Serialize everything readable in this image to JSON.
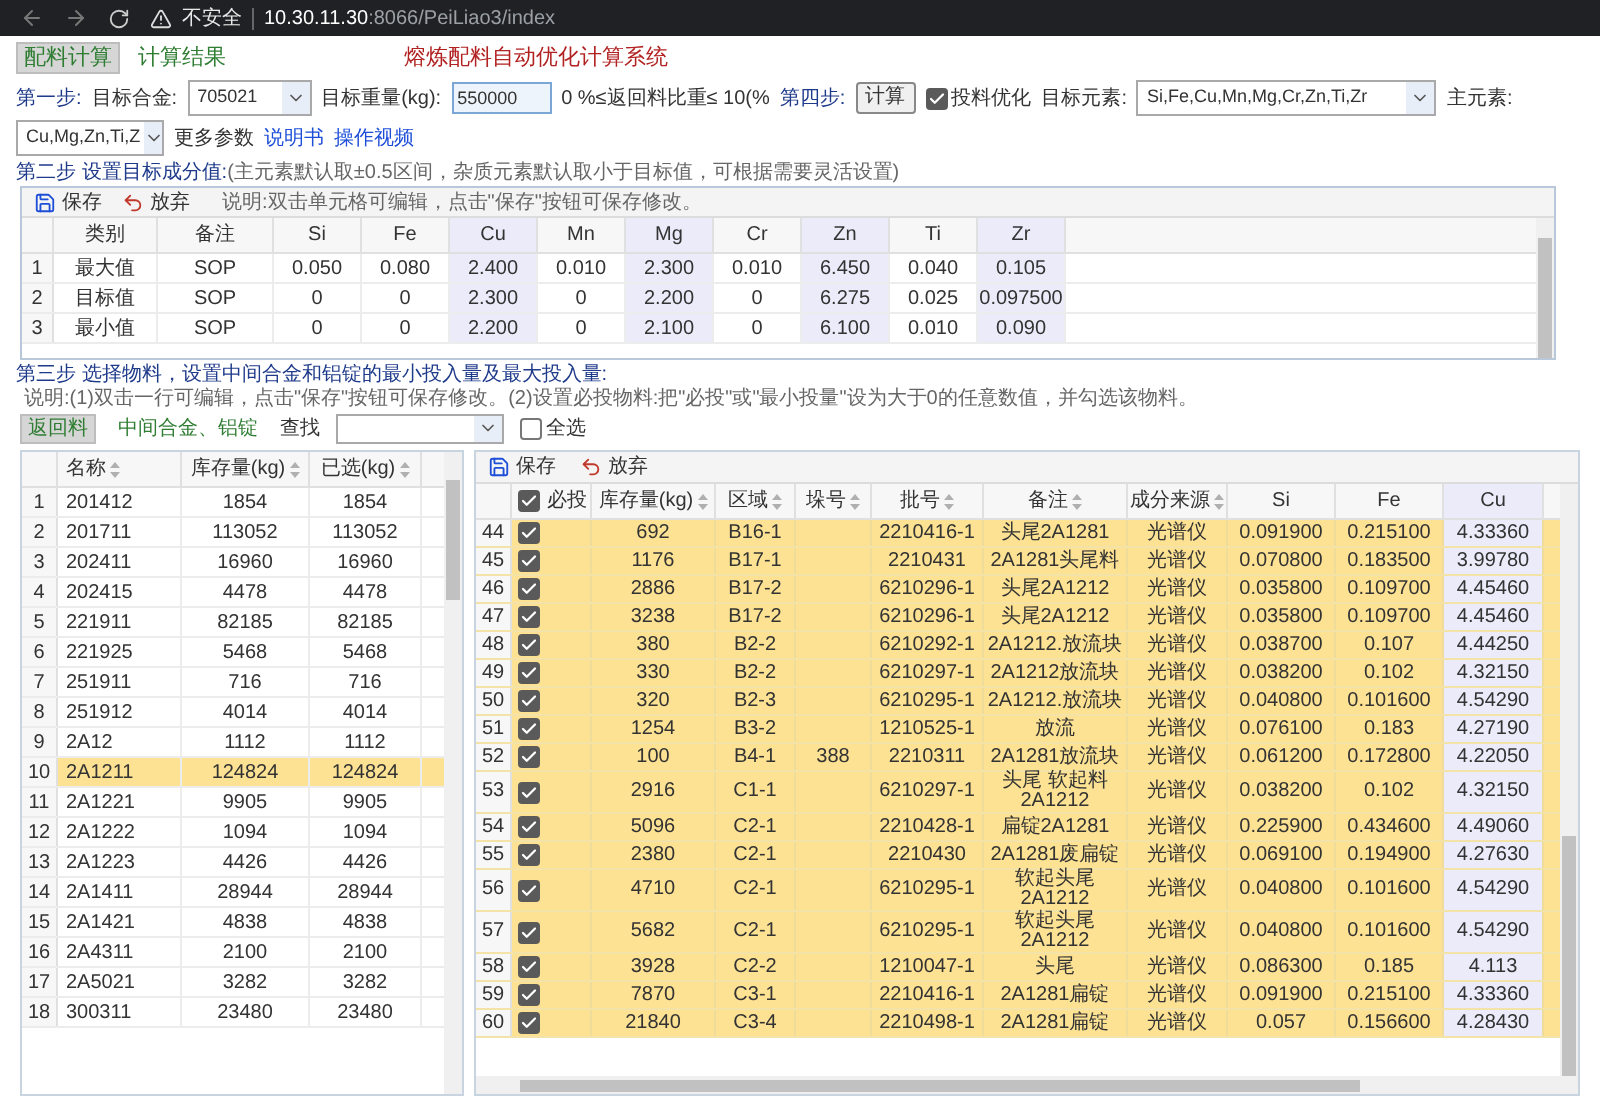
{
  "browser": {
    "security_label": "不安全",
    "url_host": "10.30.11.30",
    "url_path": ":8066/PeiLiao3/index"
  },
  "tabs": [
    {
      "label": "配料计算",
      "selected": true
    },
    {
      "label": "计算结果",
      "selected": false
    }
  ],
  "app_title": "熔炼配料自动优化计算系统",
  "step1": {
    "step_label": "第一步:",
    "alloy_label": "目标合金:",
    "alloy_value": "705021",
    "weight_label": "目标重量(kg):",
    "weight_value": "550000",
    "return_ratio": "0 %≤返回料比重≤ 10(%",
    "step4_label": "第四步:",
    "calc_button": "计算",
    "optimize": {
      "label": "投料优化",
      "checked": true
    },
    "elements_label": "目标元素:",
    "elements_value": "Si,Fe,Cu,Mn,Mg,Cr,Zn,Ti,Zr",
    "main_label": "主元素:",
    "main_value": "Cu,Mg,Zn,Ti,Z",
    "more_params": "更多参数",
    "links": [
      "说明书",
      "操作视频"
    ]
  },
  "step2": {
    "step_label": "第二步 设置目标成分值:",
    "hint": "(主元素默认取±0.5区间，杂质元素默认取小于目标值，可根据需要灵活设置)",
    "toolbar": {
      "save": "保存",
      "discard": "放弃",
      "note": "说明:双击单元格可编辑，点击\"保存\"按钮可保存修改。"
    },
    "columns": [
      {
        "label": "类别",
        "main": false
      },
      {
        "label": "备注",
        "main": false
      },
      {
        "label": "Si",
        "main": false
      },
      {
        "label": "Fe",
        "main": false
      },
      {
        "label": "Cu",
        "main": true
      },
      {
        "label": "Mn",
        "main": false
      },
      {
        "label": "Mg",
        "main": true
      },
      {
        "label": "Cr",
        "main": false
      },
      {
        "label": "Zn",
        "main": true
      },
      {
        "label": "Ti",
        "main": false
      },
      {
        "label": "Zr",
        "main": true
      }
    ],
    "rows": [
      {
        "index": "1",
        "cells": [
          "最大值",
          "SOP",
          "0.050",
          "0.080",
          "2.400",
          "0.010",
          "2.300",
          "0.010",
          "6.450",
          "0.040",
          "0.105"
        ]
      },
      {
        "index": "2",
        "cells": [
          "目标值",
          "SOP",
          "0",
          "0",
          "2.300",
          "0",
          "2.200",
          "0",
          "6.275",
          "0.025",
          "0.097500"
        ]
      },
      {
        "index": "3",
        "cells": [
          "最小值",
          "SOP",
          "0",
          "0",
          "2.200",
          "0",
          "2.100",
          "0",
          "6.100",
          "0.010",
          "0.090"
        ]
      }
    ]
  },
  "step3": {
    "step_label": "第三步 选择物料，设置中间合金和铝锭的最小投入量及最大投入量:",
    "note": "说明:(1)双击一行可编辑，点击\"保存\"按钮可保存修改。(2)设置必投物料:把\"必投\"或\"最小投量\"设为大于0的任意数值，并勾选该物料。",
    "material_tabs": [
      {
        "label": "返回料",
        "selected": true
      },
      {
        "label": "中间合金、铝锭",
        "selected": false
      }
    ],
    "search_label": "查找",
    "select_all": {
      "label": "全选",
      "checked": false
    }
  },
  "stock_table": {
    "columns": [
      {
        "label": "名称",
        "sortable": true
      },
      {
        "label": "库存量(kg)",
        "sortable": true
      },
      {
        "label": "已选(kg)",
        "sortable": true
      }
    ],
    "rows": [
      {
        "index": "1",
        "name": "201412",
        "stock": "1854",
        "chosen": "1854",
        "selected": false
      },
      {
        "index": "2",
        "name": "201711",
        "stock": "113052",
        "chosen": "113052",
        "selected": false
      },
      {
        "index": "3",
        "name": "202411",
        "stock": "16960",
        "chosen": "16960",
        "selected": false
      },
      {
        "index": "4",
        "name": "202415",
        "stock": "4478",
        "chosen": "4478",
        "selected": false
      },
      {
        "index": "5",
        "name": "221911",
        "stock": "82185",
        "chosen": "82185",
        "selected": false
      },
      {
        "index": "6",
        "name": "221925",
        "stock": "5468",
        "chosen": "5468",
        "selected": false
      },
      {
        "index": "7",
        "name": "251911",
        "stock": "716",
        "chosen": "716",
        "selected": false
      },
      {
        "index": "8",
        "name": "251912",
        "stock": "4014",
        "chosen": "4014",
        "selected": false
      },
      {
        "index": "9",
        "name": "2A12",
        "stock": "1112",
        "chosen": "1112",
        "selected": false
      },
      {
        "index": "10",
        "name": "2A1211",
        "stock": "124824",
        "chosen": "124824",
        "selected": true
      },
      {
        "index": "11",
        "name": "2A1221",
        "stock": "9905",
        "chosen": "9905",
        "selected": false
      },
      {
        "index": "12",
        "name": "2A1222",
        "stock": "1094",
        "chosen": "1094",
        "selected": false
      },
      {
        "index": "13",
        "name": "2A1223",
        "stock": "4426",
        "chosen": "4426",
        "selected": false
      },
      {
        "index": "14",
        "name": "2A1411",
        "stock": "28944",
        "chosen": "28944",
        "selected": false
      },
      {
        "index": "15",
        "name": "2A1421",
        "stock": "4838",
        "chosen": "4838",
        "selected": false
      },
      {
        "index": "16",
        "name": "2A4311",
        "stock": "2100",
        "chosen": "2100",
        "selected": false
      },
      {
        "index": "17",
        "name": "2A5021",
        "stock": "3282",
        "chosen": "3282",
        "selected": false
      },
      {
        "index": "18",
        "name": "300311",
        "stock": "23480",
        "chosen": "23480",
        "selected": false
      }
    ]
  },
  "material_table": {
    "toolbar": {
      "save": "保存",
      "discard": "放弃"
    },
    "header_checked": true,
    "columns": [
      {
        "label": "必投",
        "sortable": false,
        "main": false
      },
      {
        "label": "库存量(kg)",
        "sortable": true,
        "main": false
      },
      {
        "label": "区域",
        "sortable": true,
        "main": false
      },
      {
        "label": "垛号",
        "sortable": true,
        "main": false
      },
      {
        "label": "批号",
        "sortable": true,
        "main": false
      },
      {
        "label": "备注",
        "sortable": true,
        "main": false
      },
      {
        "label": "成分来源",
        "sortable": true,
        "main": false
      },
      {
        "label": "Si",
        "sortable": false,
        "main": false
      },
      {
        "label": "Fe",
        "sortable": false,
        "main": false
      },
      {
        "label": "Cu",
        "sortable": false,
        "main": true
      }
    ],
    "rows": [
      {
        "index": "44",
        "checked": true,
        "stock": "692",
        "area": "B16-1",
        "batch": "2210416-1",
        "remark": "头尾2A1281",
        "source": "光谱仪",
        "si": "0.091900",
        "fe": "0.215100",
        "cu": "4.33360"
      },
      {
        "index": "45",
        "checked": true,
        "stock": "1176",
        "area": "B17-1",
        "batch": "2210431",
        "remark": "2A1281头尾料",
        "source": "光谱仪",
        "si": "0.070800",
        "fe": "0.183500",
        "cu": "3.99780"
      },
      {
        "index": "46",
        "checked": true,
        "stock": "2886",
        "area": "B17-2",
        "batch": "6210296-1",
        "remark": "头尾2A1212",
        "source": "光谱仪",
        "si": "0.035800",
        "fe": "0.109700",
        "cu": "4.45460"
      },
      {
        "index": "47",
        "checked": true,
        "stock": "3238",
        "area": "B17-2",
        "batch": "6210296-1",
        "remark": "头尾2A1212",
        "source": "光谱仪",
        "si": "0.035800",
        "fe": "0.109700",
        "cu": "4.45460"
      },
      {
        "index": "48",
        "checked": true,
        "stock": "380",
        "area": "B2-2",
        "batch": "6210292-1",
        "remark": "2A1212.放流块",
        "source": "光谱仪",
        "si": "0.038700",
        "fe": "0.107",
        "cu": "4.44250"
      },
      {
        "index": "49",
        "checked": true,
        "stock": "330",
        "area": "B2-2",
        "batch": "6210297-1",
        "remark": "2A1212放流块",
        "source": "光谱仪",
        "si": "0.038200",
        "fe": "0.102",
        "cu": "4.32150"
      },
      {
        "index": "50",
        "checked": true,
        "stock": "320",
        "area": "B2-3",
        "batch": "6210295-1",
        "remark": "2A1212.放流块",
        "source": "光谱仪",
        "si": "0.040800",
        "fe": "0.101600",
        "cu": "4.54290"
      },
      {
        "index": "51",
        "checked": true,
        "stock": "1254",
        "area": "B3-2",
        "batch": "1210525-1",
        "remark": "放流",
        "source": "光谱仪",
        "si": "0.076100",
        "fe": "0.183",
        "cu": "4.27190"
      },
      {
        "index": "52",
        "checked": true,
        "stock": "100",
        "area": "B4-1",
        "stack": "388",
        "batch": "2210311",
        "remark": "2A1281放流块",
        "source": "光谱仪",
        "si": "0.061200",
        "fe": "0.172800",
        "cu": "4.22050"
      },
      {
        "index": "53",
        "checked": true,
        "stock": "2916",
        "area": "C1-1",
        "batch": "6210297-1",
        "remark": "头尾 软起料 2A1212",
        "source": "光谱仪",
        "si": "0.038200",
        "fe": "0.102",
        "cu": "4.32150"
      },
      {
        "index": "54",
        "checked": true,
        "stock": "5096",
        "area": "C2-1",
        "batch": "2210428-1",
        "remark": "扁锭2A1281",
        "source": "光谱仪",
        "si": "0.225900",
        "fe": "0.434600",
        "cu": "4.49060"
      },
      {
        "index": "55",
        "checked": true,
        "stock": "2380",
        "area": "C2-1",
        "batch": "2210430",
        "remark": "2A1281废扁锭",
        "source": "光谱仪",
        "si": "0.069100",
        "fe": "0.194900",
        "cu": "4.27630"
      },
      {
        "index": "56",
        "checked": true,
        "stock": "4710",
        "area": "C2-1",
        "batch": "6210295-1",
        "remark": "软起头尾 2A1212",
        "source": "光谱仪",
        "si": "0.040800",
        "fe": "0.101600",
        "cu": "4.54290"
      },
      {
        "index": "57",
        "checked": true,
        "stock": "5682",
        "area": "C2-1",
        "batch": "6210295-1",
        "remark": "软起头尾 2A1212",
        "source": "光谱仪",
        "si": "0.040800",
        "fe": "0.101600",
        "cu": "4.54290"
      },
      {
        "index": "58",
        "checked": true,
        "stock": "3928",
        "area": "C2-2",
        "batch": "1210047-1",
        "remark": "头尾",
        "source": "光谱仪",
        "si": "0.086300",
        "fe": "0.185",
        "cu": "4.113"
      },
      {
        "index": "59",
        "checked": true,
        "stock": "7870",
        "area": "C3-1",
        "batch": "2210416-1",
        "remark": "2A1281扁锭",
        "source": "光谱仪",
        "si": "0.091900",
        "fe": "0.215100",
        "cu": "4.33360"
      },
      {
        "index": "60",
        "checked": true,
        "stock": "21840",
        "area": "C3-4",
        "batch": "2210498-1",
        "remark": "2A1281扁锭",
        "source": "光谱仪",
        "si": "0.057",
        "fe": "0.156600",
        "cu": "4.28430"
      }
    ]
  }
}
